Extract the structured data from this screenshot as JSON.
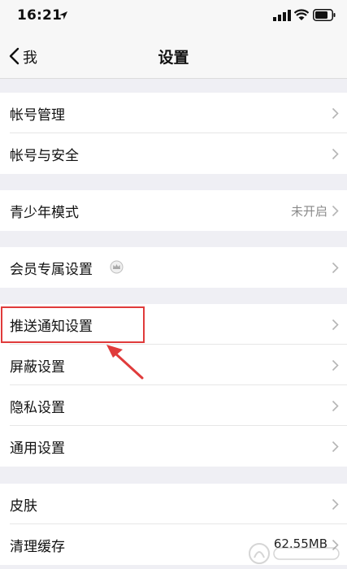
{
  "status_bar": {
    "time": "16:21"
  },
  "nav": {
    "back_label": "我",
    "title": "设置"
  },
  "groups": [
    {
      "items": [
        {
          "label": "帐号管理"
        },
        {
          "label": "帐号与安全"
        }
      ]
    },
    {
      "items": [
        {
          "label": "青少年模式",
          "value": "未开启"
        }
      ]
    },
    {
      "items": [
        {
          "label": "会员专属设置",
          "icon": "crown-icon"
        }
      ]
    },
    {
      "items": [
        {
          "label": "推送通知设置"
        },
        {
          "label": "屏蔽设置"
        },
        {
          "label": "隐私设置"
        },
        {
          "label": "通用设置"
        }
      ]
    },
    {
      "items": [
        {
          "label": "皮肤"
        },
        {
          "label": "清理缓存",
          "value": "62.55MB"
        }
      ]
    }
  ],
  "annotation": {
    "highlight_color": "#e03b3b"
  }
}
